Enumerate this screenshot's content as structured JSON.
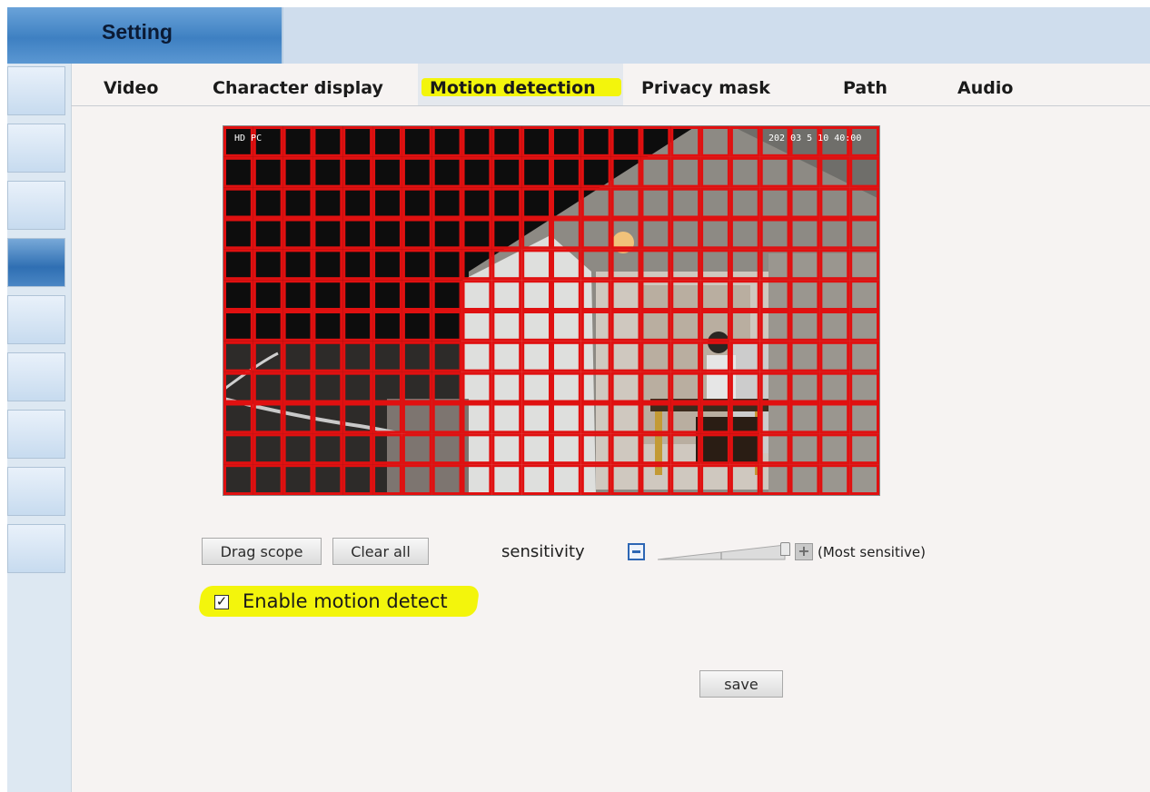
{
  "header": {
    "title": "Setting"
  },
  "sidebar": {
    "items": [
      {
        "icon": "blank-nav-button"
      },
      {
        "icon": "blank-nav-button"
      },
      {
        "icon": "blank-nav-button"
      },
      {
        "icon": "blank-nav-button",
        "active": true
      },
      {
        "icon": "blank-nav-button"
      },
      {
        "icon": "blank-nav-button"
      },
      {
        "icon": "blank-nav-button"
      },
      {
        "icon": "blank-nav-button"
      },
      {
        "icon": "blank-nav-button"
      }
    ]
  },
  "tabs": [
    {
      "label": "Video"
    },
    {
      "label": "Character display"
    },
    {
      "label": "Motion detection",
      "selected": true
    },
    {
      "label": "Privacy mask"
    },
    {
      "label": "Path"
    },
    {
      "label": "Audio"
    }
  ],
  "video": {
    "osd_left": "HD  PC",
    "osd_right": "202  03   5 10 40:00",
    "grid": {
      "columns": 22,
      "rows": 12,
      "color": "#e01010"
    }
  },
  "controls": {
    "drag_scope": "Drag scope",
    "clear_all": "Clear all",
    "sensitivity_label": "sensitivity",
    "sensitivity_level": 1.0,
    "most_sensitive": "(Most sensitive)",
    "enable_label": "Enable motion detect",
    "enable_checked": true,
    "check_glyph": "✓",
    "save": "save"
  },
  "colors": {
    "highlight": "#f3f50c",
    "title_tab": "#4a89c9",
    "topbar": "#cfdded",
    "grid_red": "#e01010"
  }
}
